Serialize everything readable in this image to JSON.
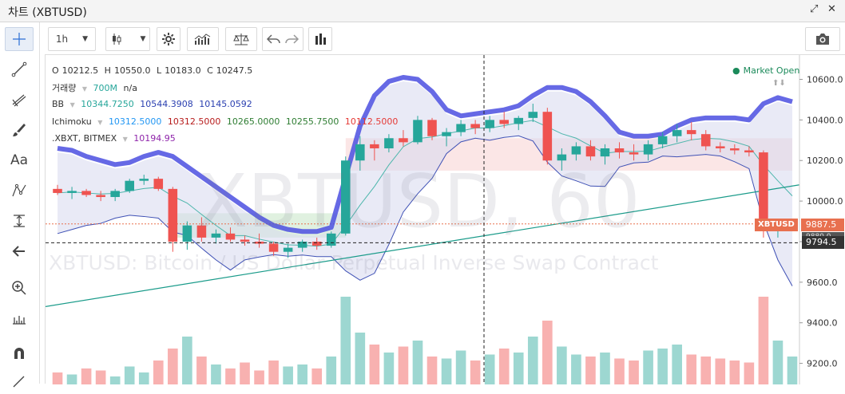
{
  "window": {
    "title": "차트 (XBTUSD)"
  },
  "toolbar": {
    "interval": "1h",
    "buttons": [
      "candle-style",
      "settings",
      "indicators",
      "compare",
      "undo",
      "redo",
      "bars"
    ]
  },
  "legend": {
    "ohlc": {
      "o_label": "O",
      "o": "10212.5",
      "h_label": "H",
      "h": "10550.0",
      "l_label": "L",
      "l": "10183.0",
      "c_label": "C",
      "c": "10247.5"
    },
    "volume": {
      "label": "거래량",
      "v1": "700M",
      "v2": "n/a"
    },
    "bb": {
      "label": "BB",
      "v1": "10344.7250",
      "v2": "10544.3908",
      "v3": "10145.0592"
    },
    "ichimoku": {
      "label": "Ichimoku",
      "v1": "10312.5000",
      "v2": "10312.5000",
      "v3": "10265.0000",
      "v4": "10255.7500",
      "v5": "10112.5000"
    },
    "index": {
      "label": ".XBXT, BITMEX",
      "v1": "10194.95"
    },
    "market_status": "Market Open"
  },
  "watermark": {
    "big": "XBTUSD, 60",
    "sub": "XBTUSD: Bitcoin / US Dollar Perpetual Inverse Swap Contract"
  },
  "price_tags": {
    "symbol": "XBTUSD",
    "last": "9887.5",
    "crosshair": "9794.5",
    "hidden": "9880.0"
  },
  "colors": {
    "bull": "#26a69a",
    "bear": "#ef5350",
    "bb_fill": "#d7d9ef",
    "blue_line": "#4b4fe0",
    "cloud_green": "#a5d6a7",
    "cloud_red": "#ef9a9a"
  },
  "chart_data": {
    "type": "candlestick",
    "ylim": [
      9100,
      10720
    ],
    "yticks": [
      "10600.0",
      "10400.0",
      "10200.0",
      "10000.0",
      "9800.0",
      "9600.0",
      "9400.0",
      "9200.0"
    ],
    "candles_approx": [
      [
        10060,
        10080,
        10030,
        10040
      ],
      [
        10040,
        10070,
        10010,
        10050
      ],
      [
        10050,
        10060,
        10020,
        10030
      ],
      [
        10030,
        10050,
        10000,
        10020
      ],
      [
        10020,
        10060,
        10000,
        10050
      ],
      [
        10050,
        10110,
        10040,
        10100
      ],
      [
        10100,
        10130,
        10080,
        10110
      ],
      [
        10110,
        10120,
        10050,
        10060
      ],
      [
        10060,
        10070,
        9750,
        9800
      ],
      [
        9800,
        9900,
        9760,
        9880
      ],
      [
        9880,
        9920,
        9800,
        9820
      ],
      [
        9820,
        9860,
        9790,
        9840
      ],
      [
        9840,
        9870,
        9800,
        9810
      ],
      [
        9810,
        9830,
        9780,
        9800
      ],
      [
        9800,
        9840,
        9770,
        9790
      ],
      [
        9790,
        9800,
        9730,
        9750
      ],
      [
        9750,
        9790,
        9720,
        9770
      ],
      [
        9770,
        9810,
        9750,
        9800
      ],
      [
        9800,
        9820,
        9760,
        9780
      ],
      [
        9780,
        9850,
        9770,
        9840
      ],
      [
        9840,
        10220,
        9830,
        10200
      ],
      [
        10200,
        10320,
        10150,
        10280
      ],
      [
        10280,
        10300,
        10200,
        10260
      ],
      [
        10260,
        10330,
        10240,
        10310
      ],
      [
        10310,
        10350,
        10270,
        10290
      ],
      [
        10290,
        10420,
        10280,
        10400
      ],
      [
        10400,
        10410,
        10300,
        10320
      ],
      [
        10320,
        10360,
        10270,
        10340
      ],
      [
        10340,
        10400,
        10320,
        10380
      ],
      [
        10380,
        10400,
        10330,
        10360
      ],
      [
        10360,
        10420,
        10340,
        10400
      ],
      [
        10400,
        10440,
        10360,
        10380
      ],
      [
        10380,
        10420,
        10350,
        10410
      ],
      [
        10410,
        10480,
        10390,
        10440
      ],
      [
        10440,
        10460,
        10180,
        10200
      ],
      [
        10200,
        10260,
        10150,
        10230
      ],
      [
        10230,
        10290,
        10200,
        10270
      ],
      [
        10270,
        10300,
        10200,
        10220
      ],
      [
        10220,
        10280,
        10180,
        10260
      ],
      [
        10260,
        10290,
        10210,
        10240
      ],
      [
        10240,
        10280,
        10200,
        10230
      ],
      [
        10230,
        10300,
        10200,
        10280
      ],
      [
        10280,
        10340,
        10260,
        10320
      ],
      [
        10320,
        10380,
        10290,
        10350
      ],
      [
        10350,
        10390,
        10300,
        10330
      ],
      [
        10330,
        10350,
        10250,
        10270
      ],
      [
        10270,
        10290,
        10240,
        10260
      ],
      [
        10260,
        10280,
        10230,
        10250
      ],
      [
        10250,
        10270,
        10220,
        10240
      ],
      [
        10240,
        10250,
        9820,
        9870
      ],
      [
        9870,
        9900,
        9820,
        9880
      ],
      [
        9880,
        9900,
        9860,
        9887.5
      ]
    ],
    "volumes_approx": [
      30,
      25,
      40,
      35,
      20,
      45,
      30,
      60,
      90,
      120,
      70,
      50,
      40,
      55,
      35,
      60,
      45,
      50,
      40,
      70,
      220,
      130,
      100,
      80,
      95,
      110,
      70,
      65,
      85,
      60,
      75,
      90,
      80,
      120,
      160,
      95,
      75,
      70,
      80,
      65,
      60,
      85,
      90,
      100,
      75,
      70,
      65,
      60,
      55,
      220,
      110,
      70
    ],
    "bb_upper_approx": [
      10240,
      10230,
      10200,
      10180,
      10160,
      10170,
      10200,
      10220,
      10200,
      10150,
      10100,
      10050,
      10000,
      9950,
      9900,
      9860,
      9840,
      9830,
      9830,
      9850,
      10100,
      10350,
      10500,
      10570,
      10590,
      10580,
      10520,
      10430,
      10400,
      10410,
      10420,
      10430,
      10450,
      10500,
      10540,
      10540,
      10520,
      10470,
      10400,
      10320,
      10300,
      10300,
      10310,
      10350,
      10380,
      10390,
      10390,
      10390,
      10380,
      10460,
      10490,
      10470
    ],
    "trendline_from": 9480,
    "trendline_to": 10080,
    "crosshair_price": 9794.5
  }
}
